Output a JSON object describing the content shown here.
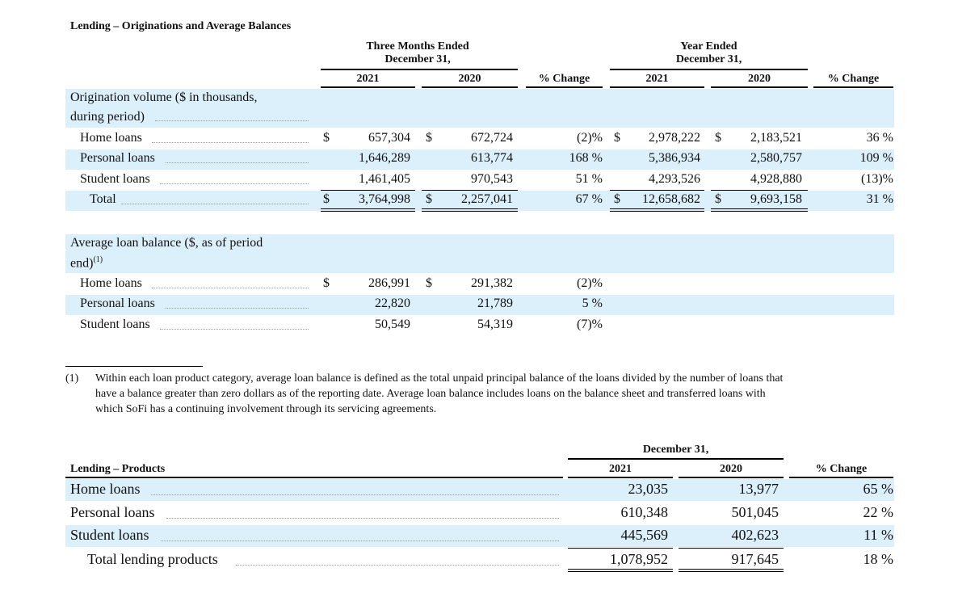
{
  "section1": {
    "title": "Lending – Originations and Average Balances",
    "header": {
      "three_months": [
        "Three Months Ended",
        "December 31,"
      ],
      "year": [
        "Year Ended",
        "December 31,"
      ],
      "y2021": "2021",
      "y2020": "2020",
      "pct_change": "% Change"
    },
    "origination": {
      "label_line1": "Origination volume ($ in thousands,",
      "label_line2": "during period)",
      "rows": [
        {
          "label": "Home loans",
          "q2021": "657,304",
          "q2020": "672,724",
          "qchg": "(2)%",
          "y2021": "2,978,222",
          "y2020": "2,183,521",
          "ychg": "36 %"
        },
        {
          "label": "Personal loans",
          "q2021": "1,646,289",
          "q2020": "613,774",
          "qchg": "168 %",
          "y2021": "5,386,934",
          "y2020": "2,580,757",
          "ychg": "109 %"
        },
        {
          "label": "Student loans",
          "q2021": "1,461,405",
          "q2020": "970,543",
          "qchg": "51 %",
          "y2021": "4,293,526",
          "y2020": "4,928,880",
          "ychg": "(13)%"
        },
        {
          "label": "Total",
          "q2021": "3,764,998",
          "q2020": "2,257,041",
          "qchg": "67 %",
          "y2021": "12,658,682",
          "y2020": "9,693,158",
          "ychg": "31 %"
        }
      ]
    },
    "average": {
      "label_line1": "Average loan balance ($, as of period",
      "label_line2": "end)",
      "footnote_marker": "(1)",
      "rows": [
        {
          "label": "Home loans",
          "q2021": "286,991",
          "q2020": "291,382",
          "qchg": "(2)%"
        },
        {
          "label": "Personal loans",
          "q2021": "22,820",
          "q2020": "21,789",
          "qchg": "5 %"
        },
        {
          "label": "Student loans",
          "q2021": "50,549",
          "q2020": "54,319",
          "qchg": "(7)%"
        }
      ]
    },
    "dollar_sign": "$"
  },
  "footnote": {
    "marker": "(1)",
    "lines": [
      "Within each loan product category, average loan balance is defined as the total unpaid principal balance of the loans divided by the number of loans that",
      "have a balance greater than zero dollars as of the reporting date. Average loan balance includes loans on the balance sheet and transferred loans with",
      "which SoFi has a continuing involvement through its servicing agreements."
    ]
  },
  "section2": {
    "title": "Lending – Products",
    "header": {
      "group": "December 31,",
      "y2021": "2021",
      "y2020": "2020",
      "pct_change": "% Change"
    },
    "rows": [
      {
        "label": "Home loans",
        "y2021": "23,035",
        "y2020": "13,977",
        "chg": "65 %"
      },
      {
        "label": "Personal loans",
        "y2021": "610,348",
        "y2020": "501,045",
        "chg": "22 %"
      },
      {
        "label": "Student loans",
        "y2021": "445,569",
        "y2020": "402,623",
        "chg": "11 %"
      },
      {
        "label": "Total lending products",
        "y2021": "1,078,952",
        "y2020": "917,645",
        "chg": "18 %"
      }
    ]
  }
}
